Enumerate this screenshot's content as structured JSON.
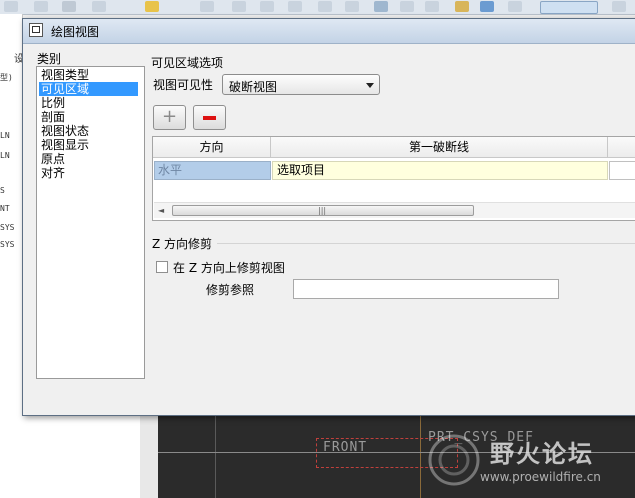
{
  "background": {
    "left_strip_labels": [
      "设",
      "型)",
      "LN",
      "LN",
      "S",
      "NT",
      "SYS",
      "SYS"
    ],
    "graphics_labels": [
      "FRONT",
      "PRT_CSYS_DEF"
    ],
    "watermark": {
      "title": "野火论坛",
      "url": "www.proewildfire.cn"
    }
  },
  "dialog": {
    "title": "绘图视图",
    "categories_label": "类别",
    "categories": [
      {
        "label": "视图类型",
        "selected": false
      },
      {
        "label": "可见区域",
        "selected": true
      },
      {
        "label": "比例",
        "selected": false
      },
      {
        "label": "剖面",
        "selected": false
      },
      {
        "label": "视图状态",
        "selected": false
      },
      {
        "label": "视图显示",
        "selected": false
      },
      {
        "label": "原点",
        "selected": false
      },
      {
        "label": "对齐",
        "selected": false
      }
    ],
    "visible_area": {
      "group_title": "可见区域选项",
      "visibility_label": "视图可见性",
      "visibility_value": "破断视图"
    },
    "buttons": {
      "add": "+",
      "remove": "−"
    },
    "table": {
      "columns": [
        "方向",
        "第一破断线"
      ],
      "rows": [
        {
          "direction": "水平",
          "first_break": "选取项目"
        }
      ]
    },
    "scrollbar_grip": "|||",
    "z_trim": {
      "group_title": "Z 方向修剪",
      "checkbox_label": "在 Z 方向上修剪视图",
      "checked": false,
      "trim_ref_label": "修剪参照",
      "trim_ref_value": ""
    }
  },
  "colors": {
    "selection": "#3399ff",
    "remove_button": "#dd1111",
    "table_highlight": "#ffffde",
    "direction_cell": "#b3cde9"
  }
}
